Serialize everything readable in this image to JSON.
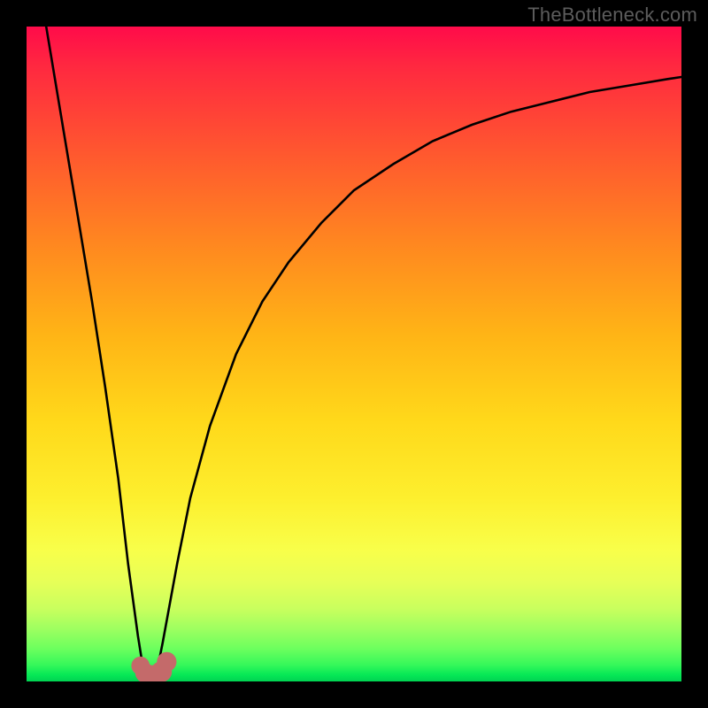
{
  "watermark": {
    "text": "TheBottleneck.com"
  },
  "chart_data": {
    "type": "line",
    "title": "",
    "xlabel": "",
    "ylabel": "",
    "xlim": [
      0,
      100
    ],
    "ylim": [
      0,
      100
    ],
    "grid": false,
    "legend": false,
    "background_gradient": {
      "direction": "vertical",
      "stops": [
        {
          "pos": 0.0,
          "color": "#ff0b4a"
        },
        {
          "pos": 0.3,
          "color": "#ff7a24"
        },
        {
          "pos": 0.6,
          "color": "#ffd81a"
        },
        {
          "pos": 0.82,
          "color": "#f6ff4c"
        },
        {
          "pos": 1.0,
          "color": "#00d252"
        }
      ]
    },
    "series": [
      {
        "name": "bottleneck-curve",
        "color": "#000000",
        "x": [
          3,
          5,
          8,
          10,
          12,
          14,
          15.5,
          17,
          17.8,
          19,
          20,
          20.8,
          23,
          25,
          28,
          32,
          36,
          40,
          45,
          50,
          56,
          62,
          68,
          74,
          80,
          86,
          92,
          98,
          100
        ],
        "y": [
          100,
          88,
          70,
          58,
          45,
          31,
          18,
          7,
          2,
          1,
          2,
          6,
          18,
          28,
          39,
          50,
          58,
          64,
          70,
          75,
          79,
          82.5,
          85,
          87,
          88.5,
          90,
          91,
          92,
          92.3
        ]
      }
    ],
    "markers": [
      {
        "name": "dot",
        "x": 17.4,
        "y": 2.4,
        "r": 1.4,
        "color": "#c46a6a"
      },
      {
        "name": "dot",
        "x": 18.1,
        "y": 1.3,
        "r": 1.5,
        "color": "#c46a6a"
      },
      {
        "name": "dot",
        "x": 19.4,
        "y": 0.9,
        "r": 1.6,
        "color": "#c46a6a"
      },
      {
        "name": "dot",
        "x": 20.6,
        "y": 1.5,
        "r": 1.6,
        "color": "#c46a6a"
      },
      {
        "name": "dot",
        "x": 21.4,
        "y": 3.0,
        "r": 1.5,
        "color": "#c46a6a"
      }
    ]
  }
}
